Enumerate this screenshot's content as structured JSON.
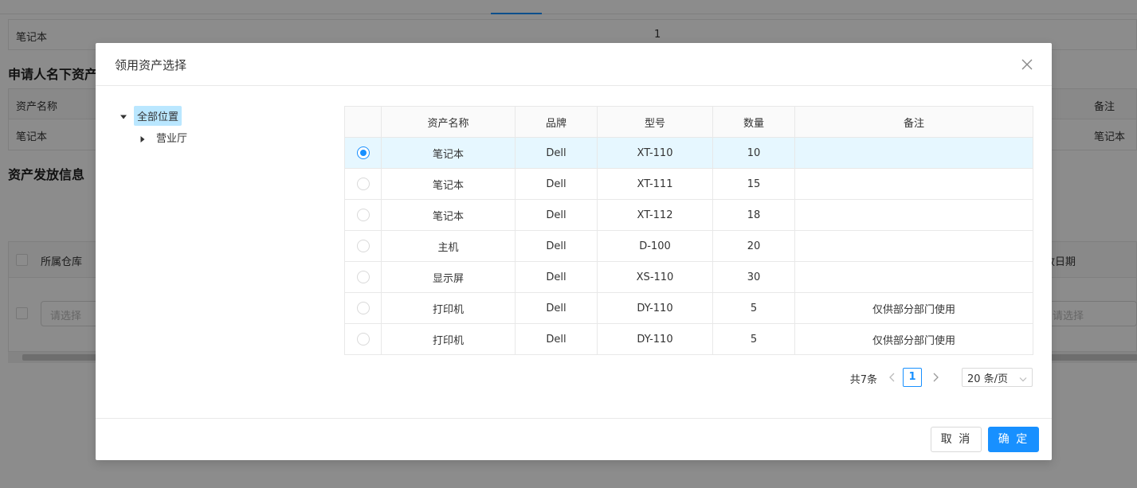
{
  "background": {
    "row1": {
      "name": "笔记本",
      "qty": "1"
    },
    "section1_title": "申请人名下资产",
    "table_head": {
      "name": "资产名称",
      "remark": "备注"
    },
    "row2": {
      "name": "笔记本",
      "remark": "笔记本"
    },
    "section2_title": "资产发放信息",
    "issue_head": {
      "warehouse": "所属仓库",
      "date": "放日期"
    },
    "issue_row": {
      "placeholder_left": "请选择",
      "placeholder_right": "请选择"
    }
  },
  "modal": {
    "title": "领用资产选择",
    "tree": {
      "root": "全部位置",
      "children": [
        "营业厅"
      ]
    },
    "table": {
      "headers": [
        "资产名称",
        "品牌",
        "型号",
        "数量",
        "备注"
      ],
      "rows": [
        {
          "name": "笔记本",
          "brand": "Dell",
          "model": "XT-110",
          "qty": "10",
          "remark": "",
          "selected": true
        },
        {
          "name": "笔记本",
          "brand": "Dell",
          "model": "XT-111",
          "qty": "15",
          "remark": "",
          "selected": false
        },
        {
          "name": "笔记本",
          "brand": "Dell",
          "model": "XT-112",
          "qty": "18",
          "remark": "",
          "selected": false
        },
        {
          "name": "主机",
          "brand": "Dell",
          "model": "D-100",
          "qty": "20",
          "remark": "",
          "selected": false
        },
        {
          "name": "显示屏",
          "brand": "Dell",
          "model": "XS-110",
          "qty": "30",
          "remark": "",
          "selected": false
        },
        {
          "name": "打印机",
          "brand": "Dell",
          "model": "DY-110",
          "qty": "5",
          "remark": "仅供部分部门使用",
          "selected": false
        },
        {
          "name": "打印机",
          "brand": "Dell",
          "model": "DY-110",
          "qty": "5",
          "remark": "仅供部分部门使用",
          "selected": false
        }
      ]
    },
    "pagination": {
      "total": "共7条",
      "current_page": "1",
      "page_size": "20 条/页"
    },
    "footer": {
      "cancel": "取 消",
      "ok": "确 定"
    }
  },
  "colors": {
    "primary": "#1890ff",
    "selected_row": "#e6f7ff",
    "tree_selected": "#bae7ff"
  },
  "icons": {
    "close": "close-icon",
    "caret_down": "caret-down-icon",
    "caret_right": "caret-right-icon",
    "chevron_left": "chevron-left-icon",
    "chevron_right": "chevron-right-icon",
    "chevron_down": "chevron-down-icon"
  }
}
